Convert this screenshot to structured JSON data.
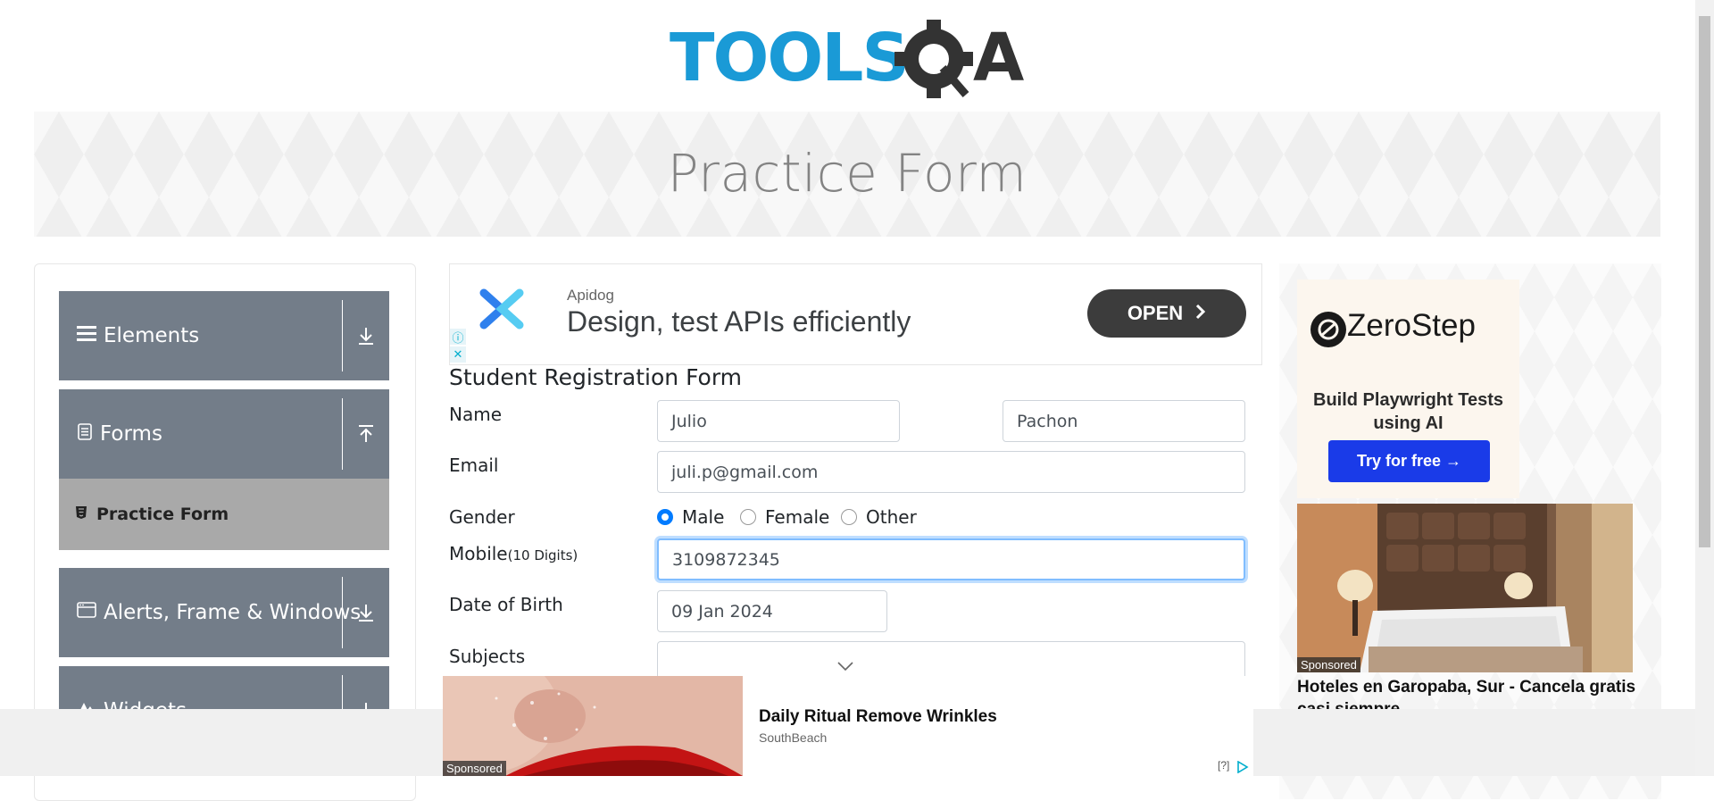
{
  "header": {
    "logo_text_left": "TOOLS",
    "logo_text_right": "A"
  },
  "banner": {
    "title": "Practice Form"
  },
  "sidebar": {
    "groups": [
      {
        "label": "Elements",
        "icon": "hamburger-icon",
        "expanded": false
      },
      {
        "label": "Forms",
        "icon": "document-icon",
        "expanded": true
      },
      {
        "label": "Alerts, Frame & Windows",
        "icon": "window-icon",
        "expanded": false
      },
      {
        "label": "Widgets",
        "icon": "widget-icon",
        "expanded": false
      }
    ],
    "active_item": {
      "label": "Practice Form",
      "icon": "html-icon"
    }
  },
  "top_ad": {
    "brand": "Apidog",
    "headline": "Design, test APIs efficiently",
    "cta": "OPEN",
    "info_glyph": "ⓘ",
    "close_glyph": "✕"
  },
  "form": {
    "title": "Student Registration Form",
    "name": {
      "label": "Name",
      "first": "Julio",
      "last": "Pachon"
    },
    "email": {
      "label": "Email",
      "value": "juli.p@gmail.com"
    },
    "gender": {
      "label": "Gender",
      "options": [
        "Male",
        "Female",
        "Other"
      ],
      "selected": "Male"
    },
    "mobile": {
      "label": "Mobile",
      "hint": "(10 Digits)",
      "value": "3109872345"
    },
    "dob": {
      "label": "Date of Birth",
      "value": "09 Jan 2024"
    },
    "subjects": {
      "label": "Subjects",
      "value": ""
    }
  },
  "right_ad": {
    "zerostep_name": "ZeroStep",
    "tagline": "Build Playwright Tests using AI",
    "cta": "Try for free →",
    "sponsored": "Sponsored",
    "hotel_title": "Hoteles en Garopaba, Sur - Cancela gratis casi siempre"
  },
  "bottom_ad": {
    "title": "Daily Ritual Remove Wrinkles",
    "source": "SouthBeach",
    "sponsored": "Sponsored",
    "help": "[?]"
  },
  "colors": {
    "sidebar_group": "#737d89",
    "sidebar_active": "#a9a9a9",
    "accent": "#007bff",
    "logo_blue": "#1a9ad6",
    "logo_dark": "#333333",
    "zerostep_button": "#1a3be8"
  }
}
